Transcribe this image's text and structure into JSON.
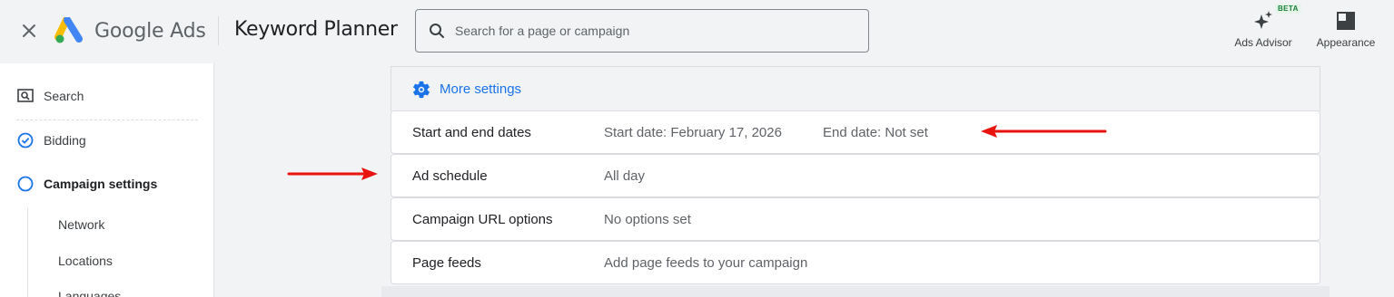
{
  "header": {
    "close_icon": "close-icon",
    "logo_text": "Google Ads",
    "tool_title": "Keyword Planner",
    "search_placeholder": "Search for a page or campaign",
    "ads_advisor_label": "Ads Advisor",
    "beta_badge": "BETA",
    "appearance_label": "Appearance"
  },
  "sidebar": {
    "items": [
      {
        "label": "Search",
        "icon": "search-icon"
      },
      {
        "label": "Bidding",
        "icon": "check-circle-icon"
      },
      {
        "label": "Campaign settings",
        "icon": "circle-icon"
      }
    ],
    "subitems": [
      {
        "label": "Network"
      },
      {
        "label": "Locations"
      },
      {
        "label": "Languages"
      }
    ]
  },
  "main": {
    "more_settings_label": "More settings",
    "rows": [
      {
        "label": "Start and end dates",
        "value": "Start date: February 17, 2026",
        "value2": "End date: Not set"
      },
      {
        "label": "Ad schedule",
        "value": "All day"
      },
      {
        "label": "Campaign URL options",
        "value": "No options set"
      },
      {
        "label": "Page feeds",
        "value": "Add page feeds to your campaign"
      }
    ]
  },
  "colors": {
    "accent": "#1a73e8",
    "annotation_arrow": "#e8130f",
    "background": "#f1f3f4"
  }
}
